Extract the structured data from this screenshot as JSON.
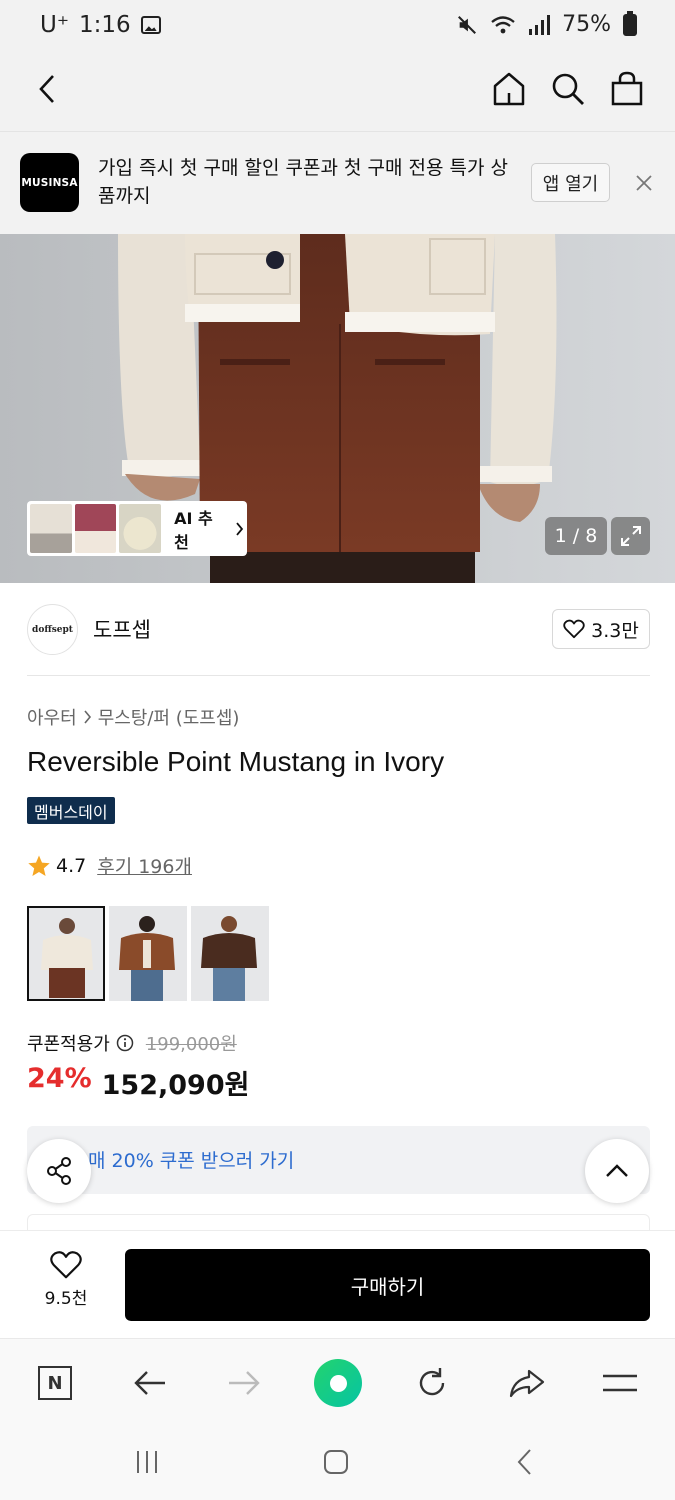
{
  "status": {
    "carrier": "U⁺",
    "time": "1:16",
    "battery": "75%"
  },
  "nav": {
    "back": "back",
    "home": "home",
    "search": "search",
    "cart": "cart"
  },
  "banner": {
    "logo": "MUSINSA",
    "text": "가입 즉시 첫 구매 할인 쿠폰과 첫 구매 전용 특가 상품까지",
    "open_app": "앱 열기"
  },
  "hero": {
    "ai_label": "AI 추천",
    "counter": "1 / 8"
  },
  "brand": {
    "logo_text": "doffsept",
    "name": "도프셉",
    "likes": "3.3만"
  },
  "product": {
    "breadcrumb": [
      "아우터",
      "무스탕/퍼 (도프셉)"
    ],
    "title": "Reversible Point Mustang in Ivory",
    "badge": "멤버스데이",
    "rating": "4.7",
    "reviews": "후기 196개",
    "colors": [
      {
        "name": "ivory",
        "coat": "#efe8dc",
        "bottom": "#6b3423",
        "selected": true
      },
      {
        "name": "brown",
        "coat": "#8a4b2a",
        "bottom": "#4e6d8f",
        "selected": false
      },
      {
        "name": "dark-brown",
        "coat": "#4a2c1f",
        "bottom": "#5e7ea0",
        "selected": false
      }
    ]
  },
  "price": {
    "coupon_label": "쿠폰적용가",
    "original": "199,000원",
    "discount": "24%",
    "final": "152,090원"
  },
  "coupon_banner": {
    "text": "매 20% 쿠폰 받으러 가기"
  },
  "purchase": {
    "wish_count": "9.5천",
    "buy_label": "구매하기"
  },
  "colors": {
    "accent_red": "#e52d2d",
    "link_blue": "#2d6ccf",
    "badge_navy": "#0f2d4d",
    "star": "#f5a623"
  }
}
